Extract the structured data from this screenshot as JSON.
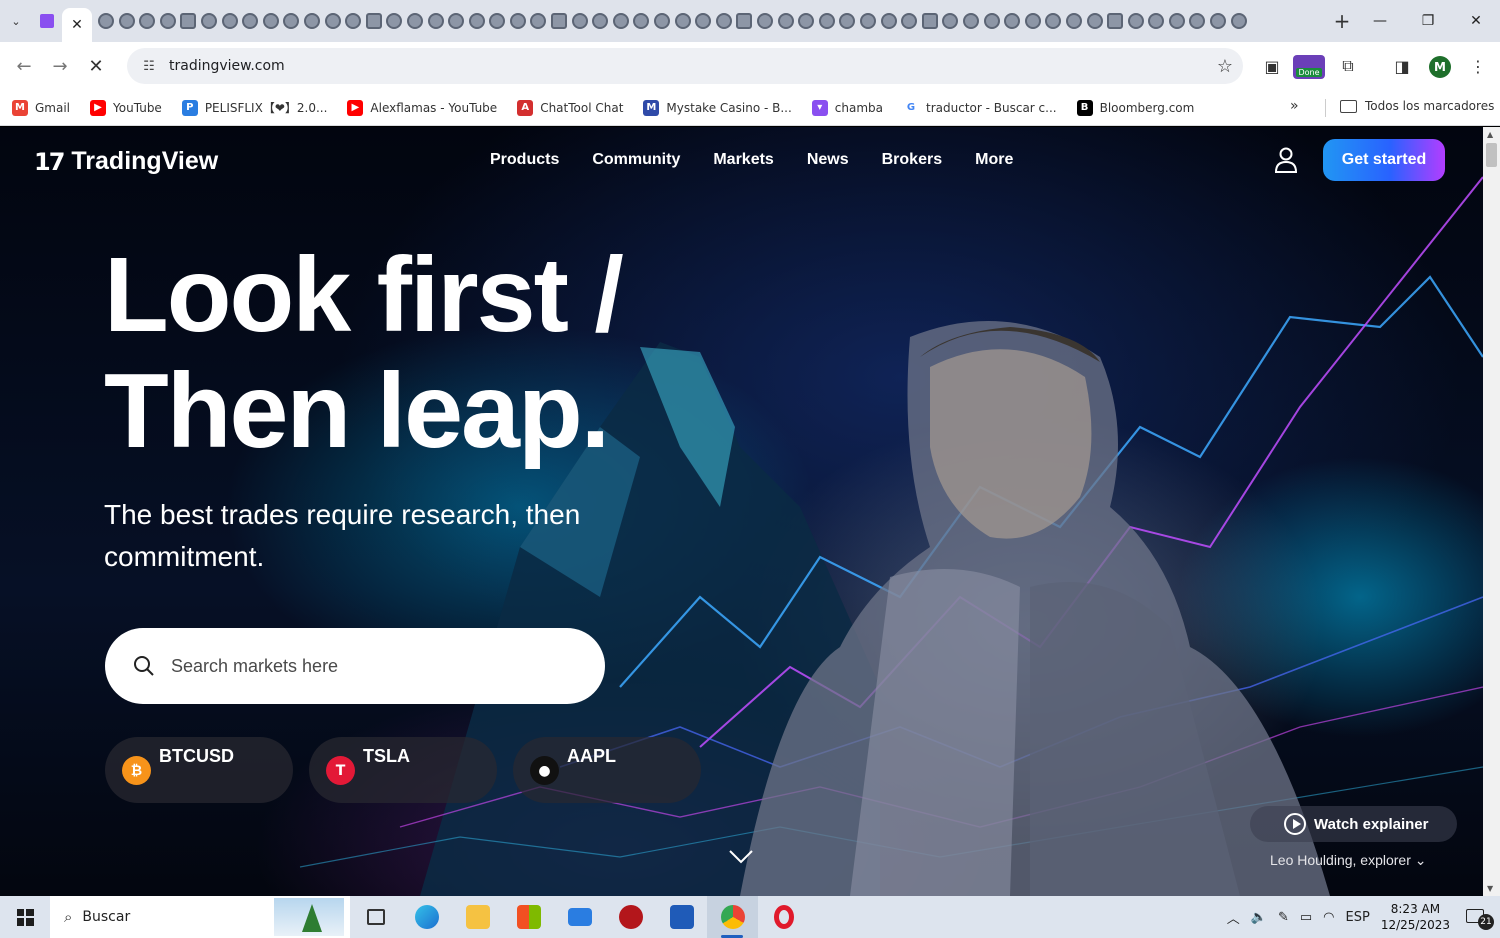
{
  "browser": {
    "active_tab_close": "✕",
    "new_tab": "+",
    "url": "tradingview.com",
    "bookmarks": [
      {
        "label": "Gmail",
        "icon": "gmail-icon",
        "color": "#ea4335",
        "glyph": "M"
      },
      {
        "label": "YouTube",
        "icon": "youtube-icon",
        "color": "#ff0000",
        "glyph": "▶"
      },
      {
        "label": "PELISFLIX【❤】2.0...",
        "icon": "pelisflix-icon",
        "color": "#2a7de1",
        "glyph": "P"
      },
      {
        "label": "Alexflamas - YouTube",
        "icon": "youtube-icon",
        "color": "#ff0000",
        "glyph": "▶"
      },
      {
        "label": "ChatTool Chat",
        "icon": "chattool-icon",
        "color": "#d32f2f",
        "glyph": "A"
      },
      {
        "label": "Mystake Casino - B...",
        "icon": "mystake-icon",
        "color": "#2f4aa8",
        "glyph": "M"
      },
      {
        "label": "chamba",
        "icon": "twitch-icon",
        "color": "#8a4ff0",
        "glyph": "▾"
      },
      {
        "label": "traductor - Buscar c...",
        "icon": "google-icon",
        "color": "#ffffff",
        "glyph": "G"
      },
      {
        "label": "Bloomberg.com",
        "icon": "bloomberg-icon",
        "color": "#000000",
        "glyph": "B"
      }
    ],
    "bookmarks_more": "»",
    "all_bookmarks": "Todos los marcadores",
    "extension_badge": "Done",
    "profile_initial": "M"
  },
  "site": {
    "brand": "TradingView",
    "brand_logo": "17",
    "nav": [
      "Products",
      "Community",
      "Markets",
      "News",
      "Brokers",
      "More"
    ],
    "cta": "Get started",
    "headline_1": "Look first /",
    "headline_2": "Then leap.",
    "subline": "The best trades require research, then commitment.",
    "search_placeholder": "Search markets here",
    "tickers": [
      {
        "symbol": "BTCUSD",
        "icon": "bitcoin-icon",
        "color": "#f7931a",
        "glyph": "₿"
      },
      {
        "symbol": "TSLA",
        "icon": "tesla-icon",
        "color": "#e31937",
        "glyph": "T"
      },
      {
        "symbol": "AAPL",
        "icon": "apple-icon",
        "color": "#111111",
        "glyph": "●"
      }
    ],
    "watch_label": "Watch explainer",
    "caption": "Leo Houlding, explorer",
    "accent_gradient": [
      "#2196f3",
      "#2962ff",
      "#b33dff"
    ]
  },
  "taskbar": {
    "search_label": "Buscar",
    "language": "ESP",
    "time": "8:23 AM",
    "date": "12/25/2023",
    "notifications": "21"
  }
}
